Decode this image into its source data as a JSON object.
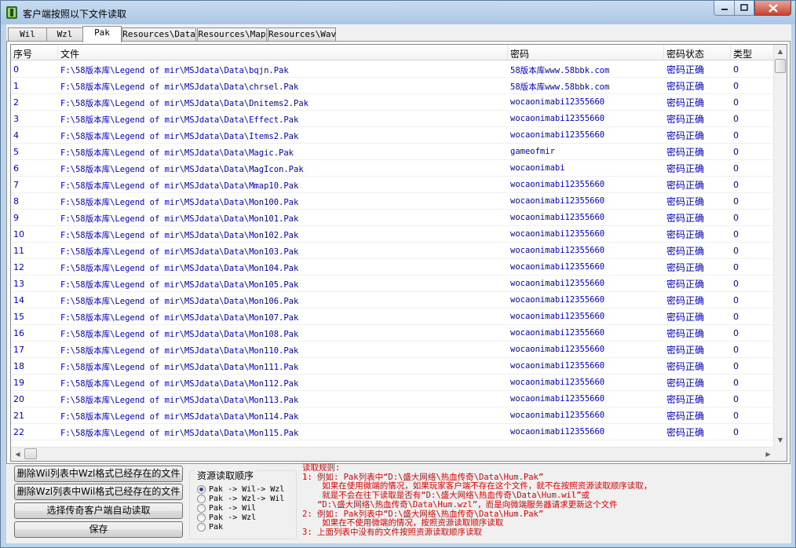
{
  "window": {
    "title": "客户端按照以下文件读取"
  },
  "tabs": [
    {
      "label": "Wil",
      "active": false
    },
    {
      "label": "Wzl",
      "active": false
    },
    {
      "label": "Pak",
      "active": true
    },
    {
      "label": "Resources\\Data",
      "active": false
    },
    {
      "label": "Resources\\Map",
      "active": false
    },
    {
      "label": "Resources\\Wav",
      "active": false
    }
  ],
  "list": {
    "columns": [
      "序号",
      "文件",
      "密码",
      "密码状态",
      "类型"
    ],
    "rows": [
      [
        "0",
        "F:\\58版本库\\Legend of mir\\MSJdata\\Data\\bqjn.Pak",
        "58版本库www.58bbk.com",
        "密码正确",
        "0"
      ],
      [
        "1",
        "F:\\58版本库\\Legend of mir\\MSJdata\\Data\\chrsel.Pak",
        "58版本库www.58bbk.com",
        "密码正确",
        "0"
      ],
      [
        "2",
        "F:\\58版本库\\Legend of mir\\MSJdata\\Data\\Dnitems2.Pak",
        "wocaonimabi12355660",
        "密码正确",
        "0"
      ],
      [
        "3",
        "F:\\58版本库\\Legend of mir\\MSJdata\\Data\\Effect.Pak",
        "wocaonimabi12355660",
        "密码正确",
        "0"
      ],
      [
        "4",
        "F:\\58版本库\\Legend of mir\\MSJdata\\Data\\Items2.Pak",
        "wocaonimabi12355660",
        "密码正确",
        "0"
      ],
      [
        "5",
        "F:\\58版本库\\Legend of mir\\MSJdata\\Data\\Magic.Pak",
        "gameofmir",
        "密码正确",
        "0"
      ],
      [
        "6",
        "F:\\58版本库\\Legend of mir\\MSJdata\\Data\\MagIcon.Pak",
        "wocaonimabi",
        "密码正确",
        "0"
      ],
      [
        "7",
        "F:\\58版本库\\Legend of mir\\MSJdata\\Data\\Mmap10.Pak",
        "wocaonimabi12355660",
        "密码正确",
        "0"
      ],
      [
        "8",
        "F:\\58版本库\\Legend of mir\\MSJdata\\Data\\Mon100.Pak",
        "wocaonimabi12355660",
        "密码正确",
        "0"
      ],
      [
        "9",
        "F:\\58版本库\\Legend of mir\\MSJdata\\Data\\Mon101.Pak",
        "wocaonimabi12355660",
        "密码正确",
        "0"
      ],
      [
        "10",
        "F:\\58版本库\\Legend of mir\\MSJdata\\Data\\Mon102.Pak",
        "wocaonimabi12355660",
        "密码正确",
        "0"
      ],
      [
        "11",
        "F:\\58版本库\\Legend of mir\\MSJdata\\Data\\Mon103.Pak",
        "wocaonimabi12355660",
        "密码正确",
        "0"
      ],
      [
        "12",
        "F:\\58版本库\\Legend of mir\\MSJdata\\Data\\Mon104.Pak",
        "wocaonimabi12355660",
        "密码正确",
        "0"
      ],
      [
        "13",
        "F:\\58版本库\\Legend of mir\\MSJdata\\Data\\Mon105.Pak",
        "wocaonimabi12355660",
        "密码正确",
        "0"
      ],
      [
        "14",
        "F:\\58版本库\\Legend of mir\\MSJdata\\Data\\Mon106.Pak",
        "wocaonimabi12355660",
        "密码正确",
        "0"
      ],
      [
        "15",
        "F:\\58版本库\\Legend of mir\\MSJdata\\Data\\Mon107.Pak",
        "wocaonimabi12355660",
        "密码正确",
        "0"
      ],
      [
        "16",
        "F:\\58版本库\\Legend of mir\\MSJdata\\Data\\Mon108.Pak",
        "wocaonimabi12355660",
        "密码正确",
        "0"
      ],
      [
        "17",
        "F:\\58版本库\\Legend of mir\\MSJdata\\Data\\Mon110.Pak",
        "wocaonimabi12355660",
        "密码正确",
        "0"
      ],
      [
        "18",
        "F:\\58版本库\\Legend of mir\\MSJdata\\Data\\Mon111.Pak",
        "wocaonimabi12355660",
        "密码正确",
        "0"
      ],
      [
        "19",
        "F:\\58版本库\\Legend of mir\\MSJdata\\Data\\Mon112.Pak",
        "wocaonimabi12355660",
        "密码正确",
        "0"
      ],
      [
        "20",
        "F:\\58版本库\\Legend of mir\\MSJdata\\Data\\Mon113.Pak",
        "wocaonimabi12355660",
        "密码正确",
        "0"
      ],
      [
        "21",
        "F:\\58版本库\\Legend of mir\\MSJdata\\Data\\Mon114.Pak",
        "wocaonimabi12355660",
        "密码正确",
        "0"
      ],
      [
        "22",
        "F:\\58版本库\\Legend of mir\\MSJdata\\Data\\Mon115.Pak",
        "wocaonimabi12355660",
        "密码正确",
        "0"
      ]
    ]
  },
  "buttons": {
    "delete_wil": "删除Wil列表中Wzl格式已经存在的文件",
    "delete_wzl": "删除Wzl列表中Wil格式已经存在的文件",
    "choose_client": "选择传奇客户端自动读取",
    "save": "保存"
  },
  "read_order": {
    "title": "资源读取顺序",
    "options": [
      {
        "label": "Pak -> Wil-> Wzl",
        "checked": true
      },
      {
        "label": "Pak -> Wzl-> Wil",
        "checked": false
      },
      {
        "label": "Pak -> Wil",
        "checked": false
      },
      {
        "label": "Pak -> Wzl",
        "checked": false
      },
      {
        "label": "Pak",
        "checked": false
      }
    ]
  },
  "rules": {
    "lines": [
      "读取规则:",
      "1: 例如: Pak列表中“D:\\盛大网络\\热血传奇\\Data\\Hum.Pak”",
      "    如果在使用微端的情况，如果玩家客户端不存在这个文件，就不在按照资源读取顺序读取，",
      "    就是不会在往下读取是否有“D:\\盛大网络\\热血传奇\\Data\\Hum.wil”或",
      "   “D:\\盛大网络\\热血传奇\\Data\\Hum.wzl”，而是向微端服务器请求更新这个文件",
      "2: 例如: Pak列表中“D:\\盛大网络\\热血传奇\\Data\\Hum.Pak”",
      "    如果在不使用微端的情况，按照资源读取顺序读取",
      "3: 上面列表中没有的文件按照资源读取顺序读取"
    ]
  },
  "colors": {
    "cell_text": "#0000cc",
    "rules_text": "#e00000",
    "window_frame": "#bcd3ea"
  }
}
